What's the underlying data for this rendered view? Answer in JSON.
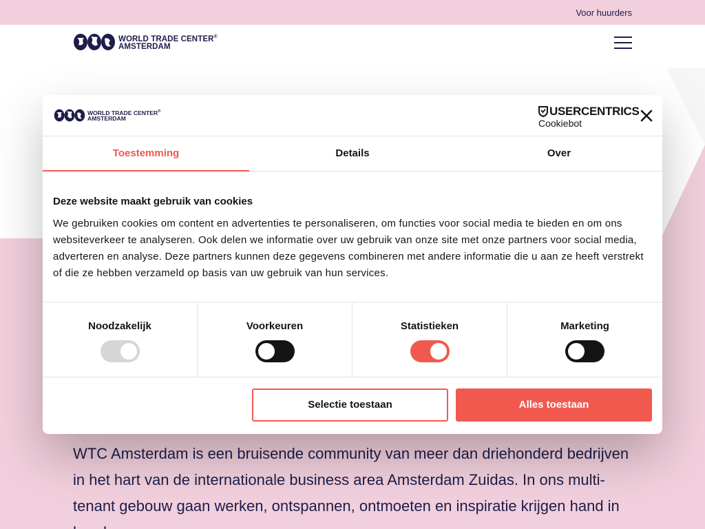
{
  "site": {
    "topbar_link": "Voor huurders",
    "logo_line1": "WORLD TRADE CENTER",
    "logo_reg": "®",
    "logo_line2": "AMSTERDAM",
    "intro": "WTC Amsterdam is een bruisende community van meer dan driehonderd bedrijven in het hart van de internationale business area Amsterdam Zuidas. In ons multi-tenant gebouw gaan werken, ontspannen, ontmoeten en inspiratie krijgen hand in hand."
  },
  "cookie_dialog": {
    "brand_line1": "USERCENTRICS",
    "brand_line2": "Cookiebot",
    "tabs": [
      {
        "label": "Toestemming",
        "active": true
      },
      {
        "label": "Details",
        "active": false
      },
      {
        "label": "Over",
        "active": false
      }
    ],
    "heading": "Deze website maakt gebruik van cookies",
    "body": "We gebruiken cookies om content en advertenties te personaliseren, om functies voor social media te bieden en om ons websiteverkeer te analyseren. Ook delen we informatie over uw gebruik van onze site met onze partners voor social media, adverteren en analyse. Deze partners kunnen deze gegevens combineren met andere informatie die u aan ze heeft verstrekt of die ze hebben verzameld op basis van uw gebruik van hun services.",
    "categories": [
      {
        "label": "Noodzakelijk",
        "state": "on",
        "disabled": true
      },
      {
        "label": "Voorkeuren",
        "state": "off",
        "disabled": false
      },
      {
        "label": "Statistieken",
        "state": "on",
        "disabled": false
      },
      {
        "label": "Marketing",
        "state": "off",
        "disabled": false
      }
    ],
    "buttons": {
      "selection": "Selectie toestaan",
      "allow_all": "Alles toestaan"
    }
  },
  "colors": {
    "accent": "#f1594f",
    "brand_navy": "#1e1d4a",
    "pink_bg": "#f1cfdc"
  },
  "icons": {
    "close": "close-icon",
    "menu": "hamburger-menu-icon",
    "usercentrics": "shield-icon",
    "logo": "wtc-globes-logo"
  }
}
